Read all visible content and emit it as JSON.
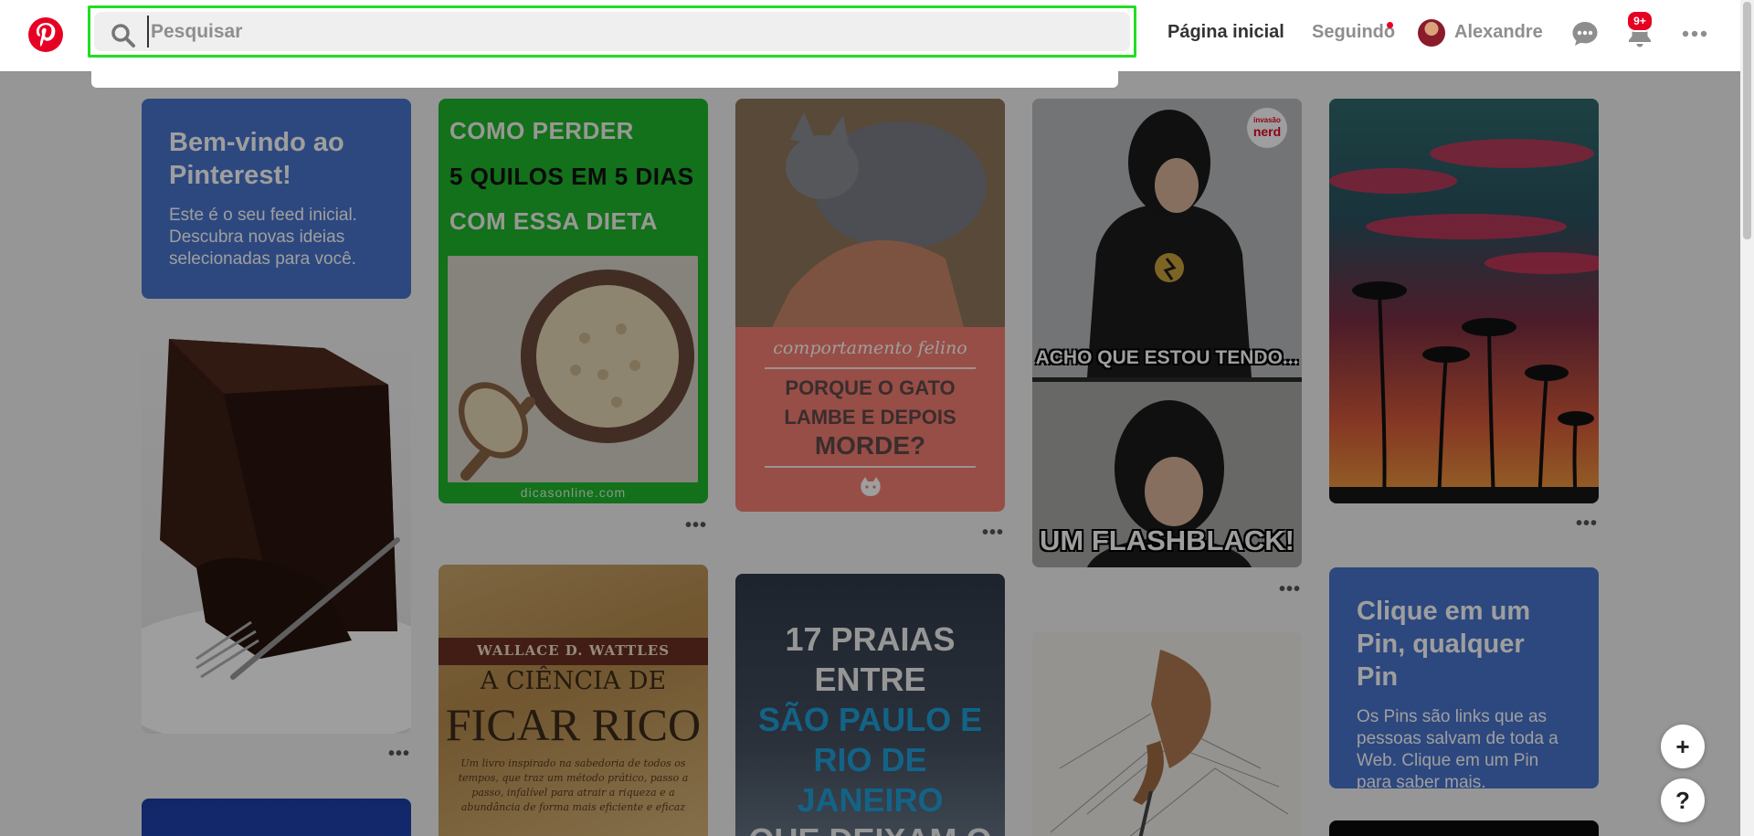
{
  "header": {
    "search_placeholder": "Pesquisar",
    "nav": {
      "home": "Página inicial",
      "following": "Seguindo",
      "user": "Alexandre"
    },
    "notifications_badge": "9+"
  },
  "pins": {
    "welcome": {
      "title": "Bem-vindo ao Pinterest!",
      "text": "Este é o seu feed inicial. Descubra novas ideias selecionadas para você."
    },
    "diet": {
      "line1": "COMO PERDER",
      "line2": "5 QUILOS EM 5 DIAS",
      "line3": "COM ESSA DIETA",
      "caption": "dicasonline.com"
    },
    "cat": {
      "subtitle": "comportamento felino",
      "line1": "PORQUE O GATO",
      "line2": "LAMBE  E DEPOIS",
      "line3": "MORDE?"
    },
    "flash": {
      "badge_top": "invasão",
      "badge_bottom": "nerd",
      "caption_top": "ACHO QUE ESTOU TENDO...",
      "caption_bottom": "UM FLASHBLACK!"
    },
    "click_pin": {
      "title": "Clique em um Pin, qualquer Pin",
      "text": "Os Pins são links que as pessoas salvam de toda a Web. Clique em um Pin para saber mais."
    },
    "book": {
      "author": "WALLACE D. WATTLES",
      "title1": "A CIÊNCIA DE",
      "title2": "FICAR RICO",
      "subtitle": "Um livro inspirado na sabedoria de todos os tempos, que traz um método prático, passo a passo, infalível para atrair a riqueza e a abundância de forma mais eficiente e eficaz"
    },
    "beach": {
      "line1": "17 PRAIAS",
      "line2": "ENTRE",
      "line3": "SÃO PAULO E",
      "line4": "RIO DE",
      "line5": "JANEIRO",
      "line6": "QUE DEIXAM O"
    },
    "more_label": "•••"
  },
  "fab": {
    "add": "+",
    "help": "?"
  },
  "colors": {
    "brand": "#e60023",
    "card_blue": "#4a75ce",
    "search_highlight": "#22dd22",
    "beach_accent": "#1fa0d8"
  }
}
